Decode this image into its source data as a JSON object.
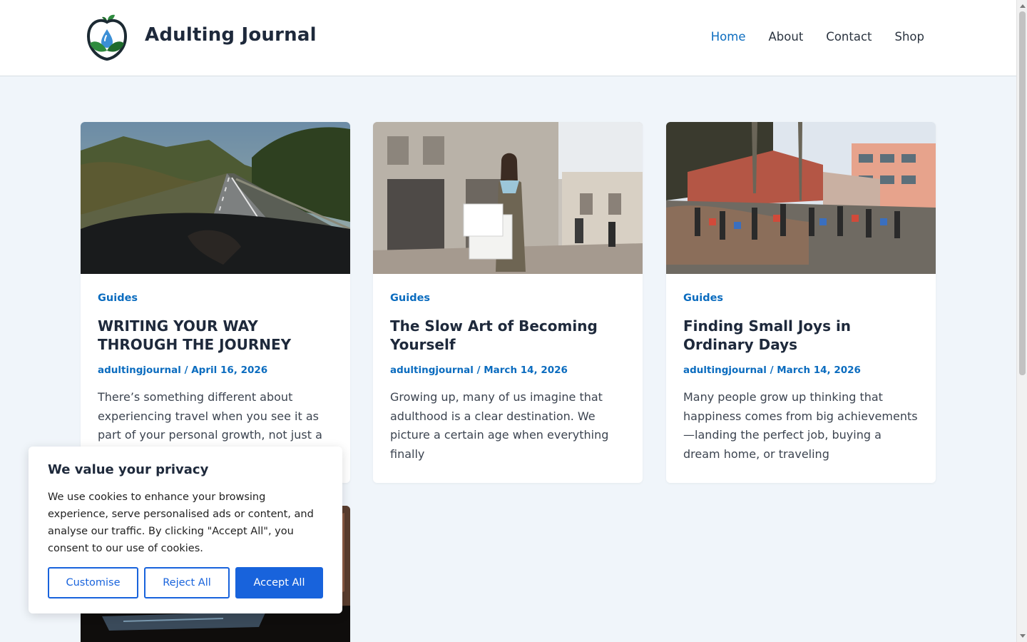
{
  "site": {
    "title": "Adulting Journal",
    "logo_icon": "apple-leaves-drop-logo",
    "colors": {
      "accent": "#0b6cbf",
      "button": "#1863dc",
      "background": "#f0f5fa"
    }
  },
  "nav": {
    "items": [
      {
        "label": "Home",
        "active": true
      },
      {
        "label": "About",
        "active": false
      },
      {
        "label": "Contact",
        "active": false
      },
      {
        "label": "Shop",
        "active": false
      }
    ]
  },
  "posts": [
    {
      "category": "Guides",
      "title": "WRITING YOUR WAY THROUGH THE JOURNEY",
      "author": "adultingjournal",
      "separator": "/",
      "date": "April 16, 2026",
      "excerpt": "There’s something different about experiencing travel when you see it as part of your personal growth, not just a",
      "image": "road-trip-photo"
    },
    {
      "category": "Guides",
      "title": "The Slow Art of Becoming Yourself",
      "author": "adultingjournal",
      "separator": "/",
      "date": "March 14, 2026",
      "excerpt": "Growing up, many of us imagine that adulthood is a clear destination. We picture a certain age when everything finally",
      "image": "woman-shopping-street-photo"
    },
    {
      "category": "Guides",
      "title": "Finding Small Joys in Ordinary Days",
      "author": "adultingjournal",
      "separator": "/",
      "date": "March 14, 2026",
      "excerpt": "Many people grow up thinking that happiness comes from big achievements—landing the perfect job, buying a dream home, or traveling",
      "image": "busy-market-photo"
    }
  ],
  "cookie_banner": {
    "title": "We value your privacy",
    "text": "We use cookies to enhance your browsing experience, serve personalised ads or content, and analyse our traffic. By clicking \"Accept All\", you consent to our use of cookies.",
    "customise_label": "Customise",
    "reject_label": "Reject All",
    "accept_label": "Accept All"
  }
}
